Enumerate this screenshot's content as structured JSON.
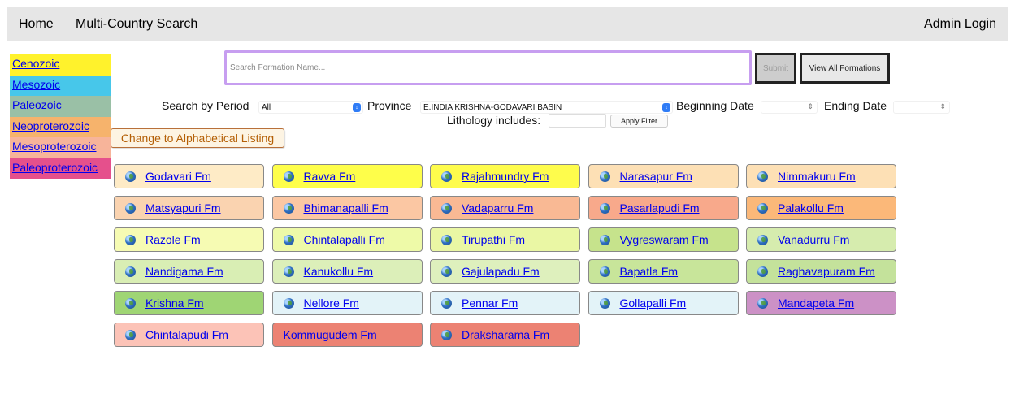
{
  "nav": {
    "home": "Home",
    "multi_country": "Multi-Country Search",
    "admin_login": "Admin Login"
  },
  "periods": [
    {
      "label": "Cenozoic",
      "color": "#fff22c"
    },
    {
      "label": "Mesozoic",
      "color": "#47c7ea"
    },
    {
      "label": "Paleozoic",
      "color": "#9ac0a6"
    },
    {
      "label": "Neoproterozoic",
      "color": "#f6b36c"
    },
    {
      "label": "Mesoproterozoic",
      "color": "#f7b49a"
    },
    {
      "label": "Paleoproterozoic",
      "color": "#e5508c"
    }
  ],
  "search": {
    "placeholder": "Search Formation Name...",
    "submit": "Submit",
    "view_all": "View All Formations"
  },
  "filters": {
    "search_by_period_label": "Search by Period",
    "period_value": "All",
    "province_label": "Province",
    "province_value": "E.INDIA KRISHNA-GODAVARI BASIN",
    "beginning_date_label": "Beginning Date",
    "ending_date_label": "Ending Date",
    "lithology_label": "Lithology includes:",
    "apply_filter": "Apply Filter"
  },
  "alphabetical_button": "Change to Alphabetical Listing",
  "formations": [
    {
      "name": "Godavari Fm",
      "color": "#feebc6",
      "icon": "globe-icon"
    },
    {
      "name": "Ravva Fm",
      "color": "#fefe4a",
      "icon": "globe-icon"
    },
    {
      "name": "Rajahmundry Fm",
      "color": "#fefc4c",
      "icon": "globe-icon"
    },
    {
      "name": "Narasapur Fm",
      "color": "#fde0b5",
      "icon": "globe-icon"
    },
    {
      "name": "Nimmakuru Fm",
      "color": "#fde0b5",
      "icon": "globe-icon"
    },
    {
      "name": "Matsyapuri Fm",
      "color": "#fad3b0",
      "icon": "globe-icon"
    },
    {
      "name": "Bhimanapalli Fm",
      "color": "#fbc7a3",
      "icon": "globe-icon"
    },
    {
      "name": "Vadaparru Fm",
      "color": "#f9b994",
      "icon": "globe-icon"
    },
    {
      "name": "Pasarlapudi Fm",
      "color": "#f8a98b",
      "icon": "globe-icon"
    },
    {
      "name": "Palakollu Fm",
      "color": "#fbb879",
      "icon": "globe-icon"
    },
    {
      "name": "Razole Fm",
      "color": "#f6fbb3",
      "icon": "globe-icon"
    },
    {
      "name": "Chintalapalli Fm",
      "color": "#eefaa8",
      "icon": "globe-icon"
    },
    {
      "name": "Tirupathi Fm",
      "color": "#eaf7a4",
      "icon": "globe-icon"
    },
    {
      "name": "Vygreswaram Fm",
      "color": "#c6e38c",
      "icon": "globe-icon"
    },
    {
      "name": "Vanadurru Fm",
      "color": "#d6ecae",
      "icon": "globe-icon"
    },
    {
      "name": "Nandigama Fm",
      "color": "#d9eeb4",
      "icon": "globe-icon"
    },
    {
      "name": "Kanukollu Fm",
      "color": "#dcefb9",
      "icon": "globe-icon"
    },
    {
      "name": "Gajulapadu Fm",
      "color": "#def0bd",
      "icon": "globe-icon"
    },
    {
      "name": "Bapatla Fm",
      "color": "#c8e59a",
      "icon": "globe-icon"
    },
    {
      "name": "Raghavapuram Fm",
      "color": "#c4e29b",
      "icon": "globe-icon"
    },
    {
      "name": "Krishna Fm",
      "color": "#9fd574",
      "icon": "globe-icon"
    },
    {
      "name": "Nellore Fm",
      "color": "#e3f3f8",
      "icon": "globe-icon"
    },
    {
      "name": "Pennar Fm",
      "color": "#e3f3f8",
      "icon": "globe-icon"
    },
    {
      "name": "Gollapalli Fm",
      "color": "#e3f3f8",
      "icon": "globe-icon"
    },
    {
      "name": "Mandapeta Fm",
      "color": "#cc91c6",
      "icon": "globe-icon"
    },
    {
      "name": "Chintalapudi Fm",
      "color": "#fcc3b7",
      "icon": "globe-icon"
    },
    {
      "name": "Kommugudem Fm",
      "color": "#ec8273",
      "icon": ""
    },
    {
      "name": "Draksharama Fm",
      "color": "#ec8273",
      "icon": "globe-icon"
    }
  ]
}
